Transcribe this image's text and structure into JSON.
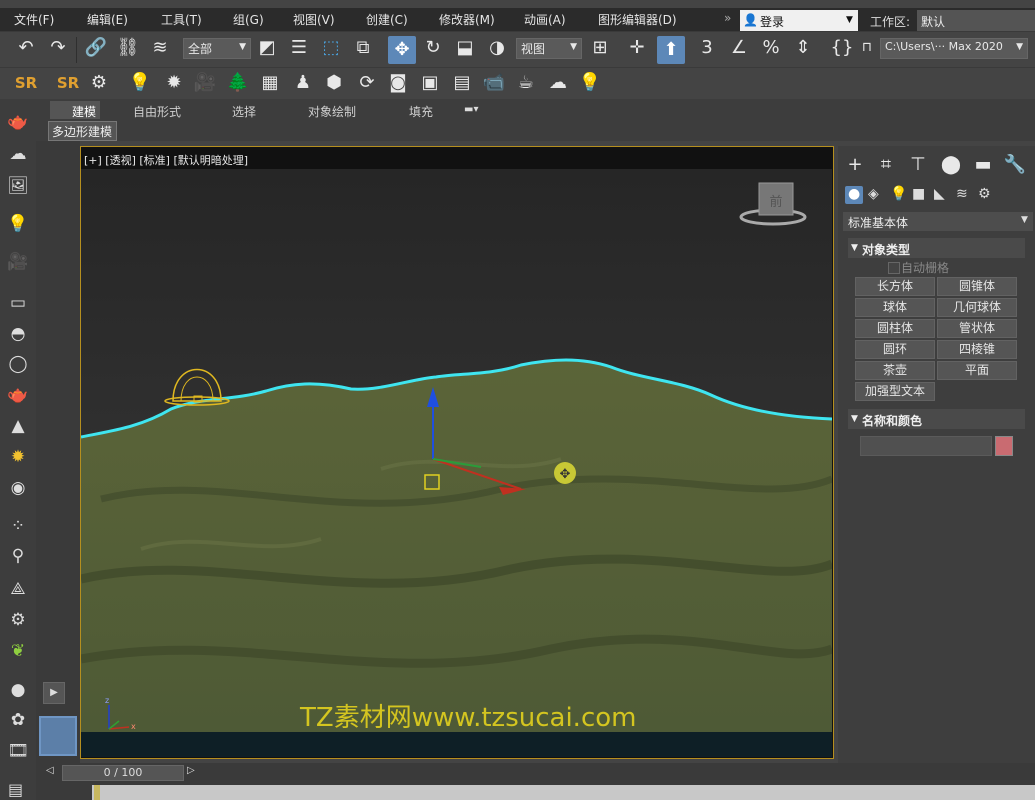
{
  "menu": {
    "items": [
      "文件(F)",
      "编辑(E)",
      "工具(T)",
      "组(G)",
      "视图(V)",
      "创建(C)",
      "修改器(M)",
      "动画(A)",
      "图形编辑器(D)"
    ],
    "login_label": "登录",
    "workspace_label": "工作区:",
    "workspace_value": "默认"
  },
  "toolbar": {
    "selection_filter": "全部",
    "reference_coord": "视图",
    "project_path": "C:\\Users\\··· Max 2020"
  },
  "ribbon": {
    "tabs": [
      "建模",
      "自由形式",
      "选择",
      "对象绘制",
      "填充"
    ],
    "subtab": "多边形建模"
  },
  "viewport": {
    "label": "[+] [透视] [标准] [默认明暗处理]",
    "viewcube_face": "前",
    "watermark": "TZ素材网www.tzsucai.com",
    "axis_z": "z",
    "axis_x": "x"
  },
  "command_panel": {
    "category_dropdown": "标准基本体",
    "object_type_header": "对象类型",
    "autogrid_label": "自动栅格",
    "object_buttons": [
      "长方体",
      "圆锥体",
      "球体",
      "几何球体",
      "圆柱体",
      "管状体",
      "圆环",
      "四棱锥",
      "茶壶",
      "平面",
      "加强型文本"
    ],
    "name_color_header": "名称和颜色",
    "name_value": "",
    "object_color": "#c96b71"
  },
  "timeline": {
    "frame_display": "0 / 100"
  },
  "colors": {
    "terrain": "#5a6339",
    "highlight_edge": "#3fe5f0",
    "viewport_border": "#b58f1f",
    "watermark": "#d4c520"
  }
}
